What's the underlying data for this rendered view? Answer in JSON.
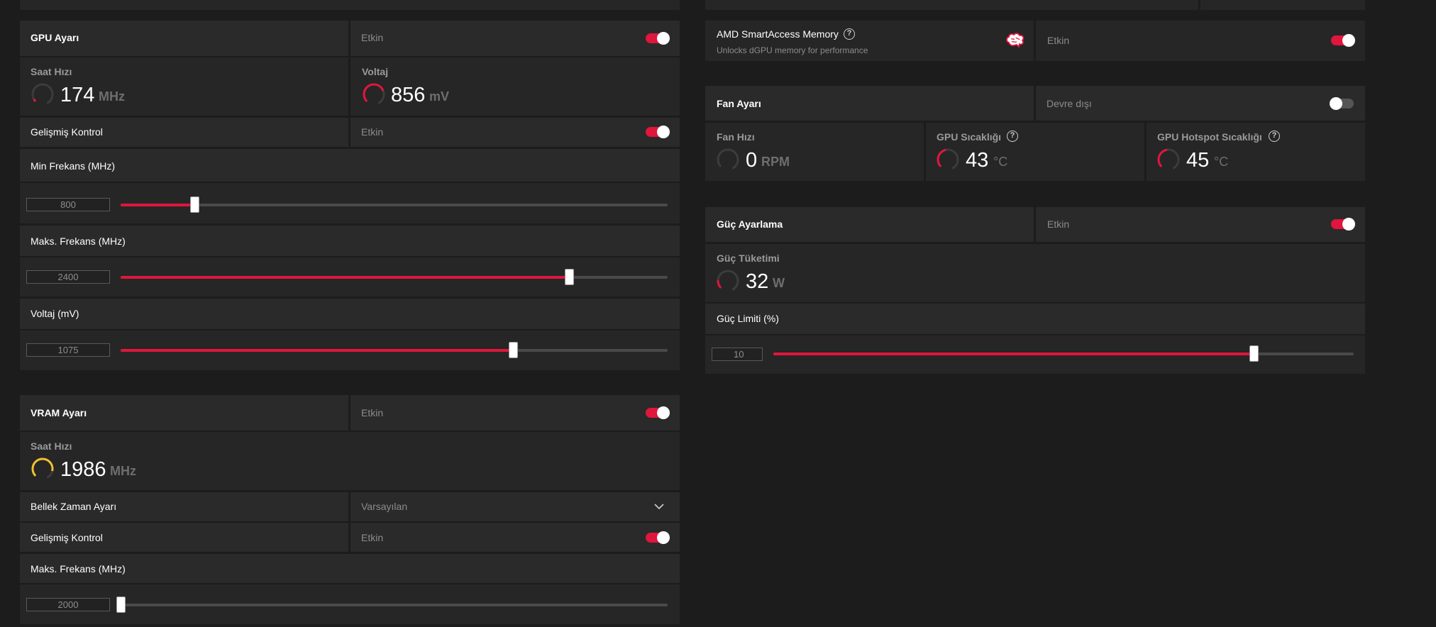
{
  "accent_color": "#e0163c",
  "gauge_yellow": "#f2c12e",
  "gpu": {
    "title": "GPU Ayarı",
    "toggle_label": "Etkin",
    "toggle_on": true,
    "clock": {
      "label": "Saat Hızı",
      "value": "174",
      "unit": "MHz"
    },
    "voltage": {
      "label": "Voltaj",
      "value": "856",
      "unit": "mV"
    },
    "advanced": {
      "label": "Gelişmiş Kontrol",
      "toggle_label": "Etkin",
      "toggle_on": true
    },
    "min_freq": {
      "label": "Min Frekans (MHz)",
      "value": "800",
      "fraction": 0.135
    },
    "max_freq": {
      "label": "Maks. Frekans (MHz)",
      "value": "2400",
      "fraction": 0.82
    },
    "voltage_slider": {
      "label": "Voltaj (mV)",
      "value": "1075",
      "fraction": 0.717
    }
  },
  "vram": {
    "title": "VRAM Ayarı",
    "toggle_label": "Etkin",
    "toggle_on": true,
    "clock": {
      "label": "Saat Hızı",
      "value": "1986",
      "unit": "MHz"
    },
    "timing": {
      "label": "Bellek Zaman Ayarı",
      "value": "Varsayılan"
    },
    "advanced": {
      "label": "Gelişmiş Kontrol",
      "toggle_label": "Etkin",
      "toggle_on": true
    },
    "max_freq": {
      "label": "Maks. Frekans (MHz)",
      "value": "2000",
      "fraction": 0.0
    }
  },
  "sam": {
    "title": "AMD SmartAccess Memory",
    "subtitle": "Unlocks dGPU memory for performance",
    "toggle_label": "Etkin",
    "toggle_on": true,
    "icon": "brain-icon"
  },
  "fan": {
    "title": "Fan Ayarı",
    "toggle_label": "Devre dışı",
    "toggle_on": false,
    "speed": {
      "label": "Fan Hızı",
      "value": "0",
      "unit": "RPM"
    },
    "gpu_temp": {
      "label": "GPU Sıcaklığı",
      "value": "43",
      "unit": "°C"
    },
    "hotspot_temp": {
      "label": "GPU Hotspot Sıcaklığı",
      "value": "45",
      "unit": "°C"
    }
  },
  "power": {
    "title": "Güç Ayarlama",
    "toggle_label": "Etkin",
    "toggle_on": true,
    "consumption": {
      "label": "Güç Tüketimi",
      "value": "32",
      "unit": "W"
    },
    "limit": {
      "label": "Güç Limiti (%)",
      "value": "10",
      "fraction": 0.828
    }
  }
}
